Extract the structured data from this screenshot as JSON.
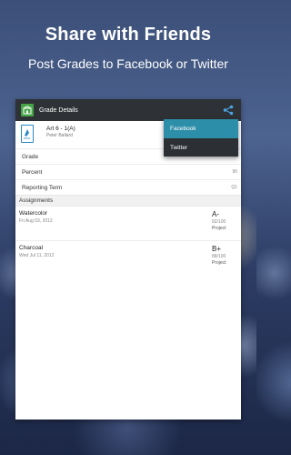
{
  "promo": {
    "headline": "Share with Friends",
    "subline": "Post Grades to Facebook or Twitter"
  },
  "actionbar": {
    "title": "Grade Details",
    "icon": "gradebook-app-icon",
    "share_icon": "share-icon"
  },
  "course": {
    "title": "Art 6 - 1(A)",
    "teacher": "Peter Ballard"
  },
  "details": [
    {
      "label": "Grade",
      "value": "A"
    },
    {
      "label": "Percent",
      "value": "90"
    },
    {
      "label": "Reporting Term",
      "value": "Q1"
    }
  ],
  "assignments_header": "Assignments",
  "assignments": [
    {
      "name": "Watercolor",
      "date": "Fri Aug 03, 2012",
      "grade": "A-",
      "score": "92/100",
      "type": "Project"
    },
    {
      "name": "Charcoal",
      "date": "Wed Jul 11, 2012",
      "grade": "B+",
      "score": "88/100",
      "type": "Project"
    }
  ],
  "share_menu": [
    {
      "label": "Facebook",
      "selected": true
    },
    {
      "label": "Twitter",
      "selected": false
    }
  ],
  "colors": {
    "accent": "#2c8ea8",
    "actionbar": "#2e3135",
    "app_icon": "#47a547",
    "doc_icon": "#2a88c8"
  }
}
